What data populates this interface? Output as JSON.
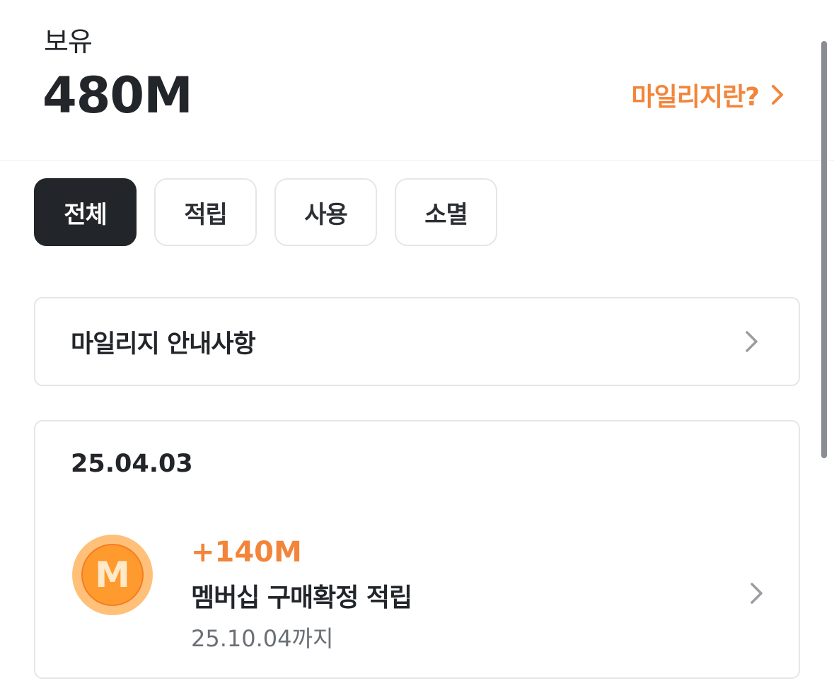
{
  "header": {
    "hold_label": "보유",
    "hold_value": "480M",
    "what_link": "마일리지란?",
    "accent_color": "#f2853a"
  },
  "filters": {
    "tabs": [
      {
        "label": "전체",
        "selected": true
      },
      {
        "label": "적립",
        "selected": false
      },
      {
        "label": "사용",
        "selected": false
      },
      {
        "label": "소멸",
        "selected": false
      }
    ]
  },
  "notice": {
    "title": "마일리지 안내사항"
  },
  "history": {
    "date": "25.04.03",
    "entries": [
      {
        "icon": "mileage-coin-icon",
        "coin_letter": "M",
        "amount": "+140M",
        "title": "멤버십 구매확정 적립",
        "expiry": "25.10.04까지"
      }
    ]
  }
}
